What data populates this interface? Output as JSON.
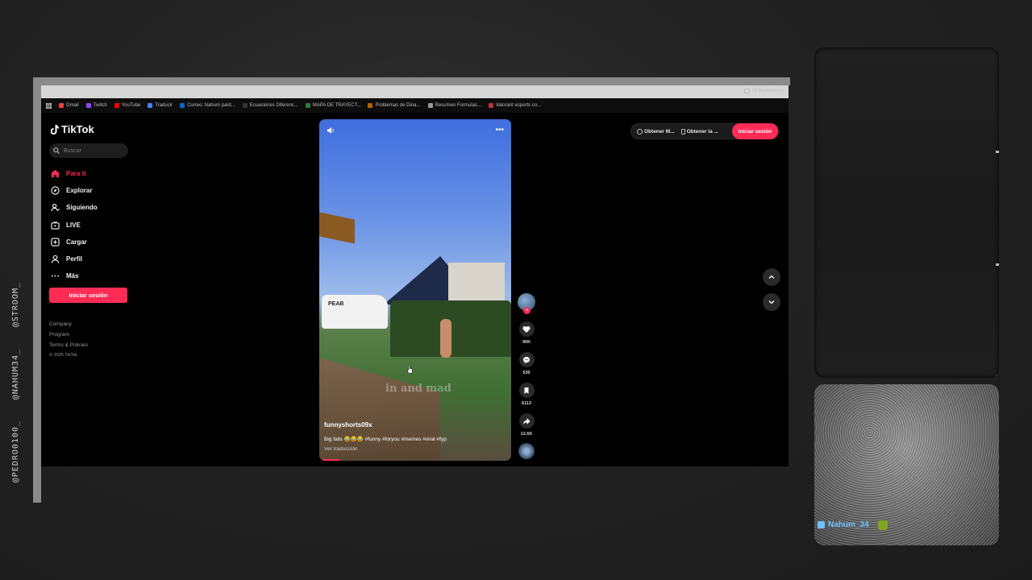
{
  "stream_tags": [
    "@STROOM_",
    "@NAHUM34_",
    "@PEDRO0100_"
  ],
  "bookmarks": [
    {
      "label": "Gmail",
      "color": "#ea4335"
    },
    {
      "label": "Twitch",
      "color": "#9146ff"
    },
    {
      "label": "YouTube",
      "color": "#ff0000"
    },
    {
      "label": "Traducir",
      "color": "#4285f4"
    },
    {
      "label": "Correo: Nahum pard...",
      "color": "#0a66c2"
    },
    {
      "label": "Ecuaciones Diferenc...",
      "color": "#333333"
    },
    {
      "label": "MAPA DE TRAYECT...",
      "color": "#2e7d32"
    },
    {
      "label": "Problemas de Dina...",
      "color": "#b06000"
    },
    {
      "label": "Resumen Formulas...",
      "color": "#999999"
    },
    {
      "label": "Valorant esports co...",
      "color": "#bb3333"
    }
  ],
  "bookmarks_all": "All Bookmarks",
  "tiktok": {
    "logo": "TikTok",
    "search_placeholder": "Buscar",
    "nav": [
      {
        "label": "Para ti",
        "icon": "home-icon",
        "active": true
      },
      {
        "label": "Explorar",
        "icon": "compass-icon",
        "active": false
      },
      {
        "label": "Siguiendo",
        "icon": "following-icon",
        "active": false
      },
      {
        "label": "LIVE",
        "icon": "live-icon",
        "active": false
      },
      {
        "label": "Cargar",
        "icon": "upload-icon",
        "active": false
      },
      {
        "label": "Perfil",
        "icon": "profile-icon",
        "active": false
      },
      {
        "label": "Más",
        "icon": "more-icon",
        "active": false
      }
    ],
    "login_label": "Iniciar sesión",
    "footer": {
      "company": "Company",
      "program": "Program",
      "terms": "Terms & Policies",
      "copyright": "© 2025 TikTok"
    },
    "top": {
      "get_app": "Obtener M...",
      "get_desktop": "Obtener la ...",
      "login": "Iniciar sesión"
    }
  },
  "video": {
    "overlay_text": "in and mad",
    "van_text": "PEAB",
    "author": "funnyshorts09x",
    "caption": "Big fails 😂😂😂 #funny #foryou #memes #viral #fyp",
    "translate": "Ver traducción",
    "progress": 0.09
  },
  "actions": {
    "likes": "90K",
    "comments": "530",
    "saves": "6113",
    "shares": "12.6K"
  },
  "chat": {
    "username": "Nahum_34"
  },
  "colors": {
    "accent": "#fe2c55",
    "chat_user": "#6ec3ff"
  }
}
